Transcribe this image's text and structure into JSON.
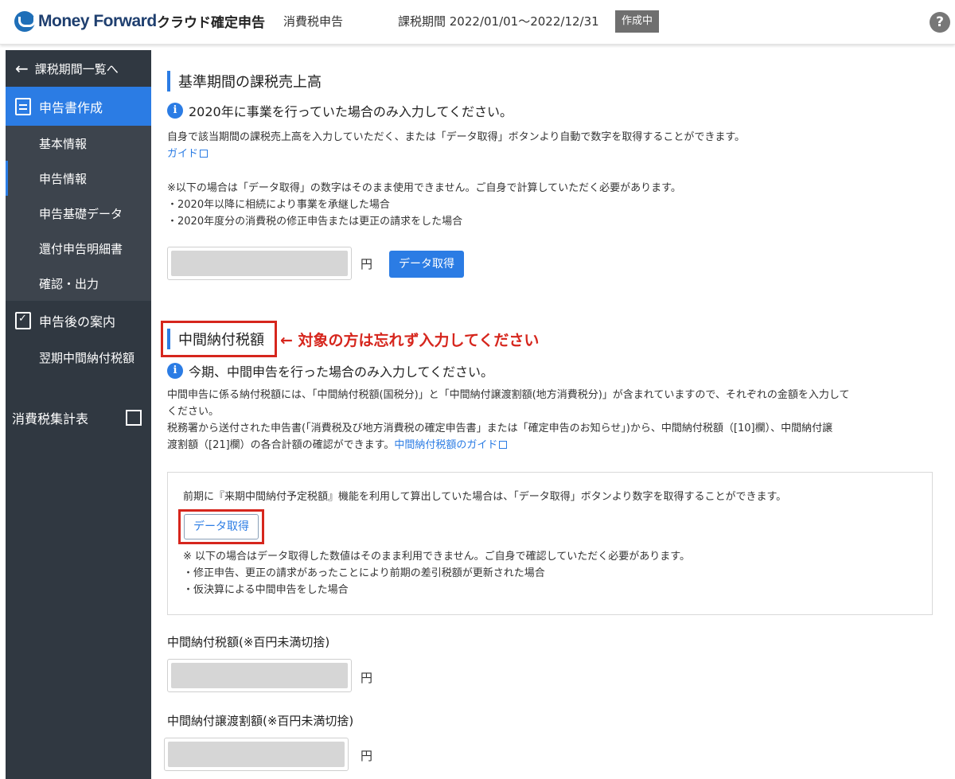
{
  "header": {
    "logo_text": "Money Forward",
    "product": "クラウド確定申告",
    "mode": "消費税申告",
    "period": "課税期間 2022/01/01〜2022/12/31",
    "status": "作成中",
    "help": "?"
  },
  "sidebar": {
    "back": "課税期間一覧へ",
    "section_create": "申告書作成",
    "items": [
      "基本情報",
      "申告情報",
      "申告基礎データ",
      "還付申告明細書",
      "確認・出力"
    ],
    "section_after": "申告後の案内",
    "after_items": [
      "翌期中間納付税額"
    ],
    "external": "消費税集計表"
  },
  "section1": {
    "title": "基準期間の課税売上高",
    "info": "2020年に事業を行っていた場合のみ入力してください。",
    "desc": "自身で該当期間の課税売上高を入力していただく、または「データ取得」ボタンより自動で数字を取得することができます。",
    "guide": "ガイド",
    "note_title": "※以下の場合は「データ取得」の数字はそのまま使用できません。ご自身で計算していただく必要があります。",
    "note_1": "・2020年以降に相続により事業を承継した場合",
    "note_2": "・2020年度分の消費税の修正申告または更正の請求をした場合",
    "yen": "円",
    "fetch_button": "データ取得"
  },
  "section2": {
    "title": "中間納付税額",
    "annotation": "← 対象の方は忘れず入力してください",
    "info": "今期、中間申告を行った場合のみ入力してください。",
    "desc_1": "中間申告に係る納付税額には、「中間納付税額(国税分)」と「中間納付譲渡割額(地方消費税分)」が含まれていますので、それぞれの金額を入力して",
    "desc_2": "ください。",
    "desc_3": "税務署から送付された申告書(「消費税及び地方消費税の確定申告書」または「確定申告のお知らせ」)から、中間納付税額（[10]欄）、中間納付譲",
    "desc_4": "渡割額（[21]欄）の各合計額の確認ができます。",
    "guide": "中間納付税額のガイド",
    "panel_text": "前期に『来期中間納付予定税額』機能を利用して算出していた場合は、「データ取得」ボタンより数字を取得することができます。",
    "fetch_button": "データ取得",
    "panel_note_title": "※ 以下の場合はデータ取得した数値はそのまま利用できません。ご自身で確認していただく必要があります。",
    "panel_note_1": "・修正申告、更正の請求があったことにより前期の差引税額が更新された場合",
    "panel_note_2": "・仮決算による中間申告をした場合",
    "field1_label": "中間納付税額(※百円未満切捨)",
    "field2_label": "中間納付譲渡割額(※百円未満切捨)",
    "yen": "円"
  },
  "colors": {
    "accent": "#2b7ce4",
    "sidebar": "#303841",
    "annotation": "#d6261d"
  }
}
